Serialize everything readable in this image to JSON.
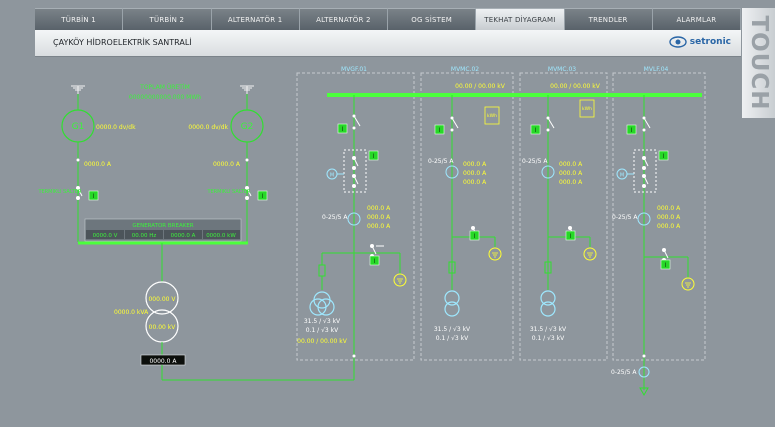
{
  "nav": [
    "TÜRBİN 1",
    "TÜRBİN 2",
    "ALTERNATÖR 1",
    "ALTERNATÖR 2",
    "OG SİSTEM",
    "TEKHAT DİYAGRAMI",
    "TRENDLER",
    "ALARMLAR"
  ],
  "active_tab": 5,
  "header": {
    "title": "ÇAYKÖY HİDROELEKTRİK SANTRALİ",
    "brand": "setronic"
  },
  "touch_label": "TOUCH",
  "gen": {
    "total_label": "TOPLAM ÜRETİM",
    "total_value": "00000000000.000 MWh",
    "g1": {
      "label": "G1",
      "speed": "0000.0 dv/dk",
      "current": "0000.0 A",
      "switch": "TERMIKLI SALTER"
    },
    "g2": {
      "label": "G2",
      "speed": "0000.0 dv/dk",
      "current": "0000.0 A",
      "switch": "TERMIKLI SALTER"
    },
    "breaker_label": "GENERATOR BREAKER",
    "breaker_values": [
      "0000.0 V",
      "00.00 Hz",
      "0000.0 A",
      "0000.0 kW"
    ],
    "transformer": {
      "v_hi": "000.00 V",
      "v_lo": "00.00 kV",
      "power": "0000.0 kVA"
    },
    "bottom_current": "0000.0 A"
  },
  "panels": {
    "p1": {
      "name": "MVGF.01",
      "ct": "0-25/5 A",
      "amps": [
        "000.0 A",
        "000.0 A",
        "000.0 A"
      ],
      "tr_ratio": "31.5 / √3 kV",
      "tr_ratio2": "0.1 / √3 kV",
      "reading": "00.00 / 00.00 kV"
    },
    "p2": {
      "name": "MVMC.02",
      "ct": "0-25/5 A",
      "amps": [
        "000.0 A",
        "000.0 A",
        "000.0 A"
      ],
      "tr_ratio": "31.5 / √3 kV",
      "tr_ratio2": "0.1 / √3 kV",
      "bus_reading": "00.00 / 00.00 kV",
      "meter": "kWh"
    },
    "p3": {
      "name": "MVMC.03",
      "ct": "0-25/5 A",
      "amps": [
        "000.0 A",
        "000.0 A",
        "000.0 A"
      ],
      "tr_ratio": "31.5 / √3 kV",
      "tr_ratio2": "0.1 / √3 kV",
      "bus_reading": "00.00 / 00.00 kV",
      "meter": "kWh"
    },
    "p4": {
      "name": "MVLF.04",
      "ct": "0-25/5 A",
      "amps": [
        "000.0 A",
        "000.0 A",
        "000.0 A"
      ],
      "ct2": "0-25/5 A"
    }
  },
  "switch_mark": "I",
  "motor_mark": "M",
  "colors": {
    "line": "#30e030",
    "bus": "#4bff3b",
    "text_green": "#3cf23c",
    "text_yellow": "#ffff33",
    "text_cyan": "#9ee8ff",
    "box_green": "#27d827"
  }
}
